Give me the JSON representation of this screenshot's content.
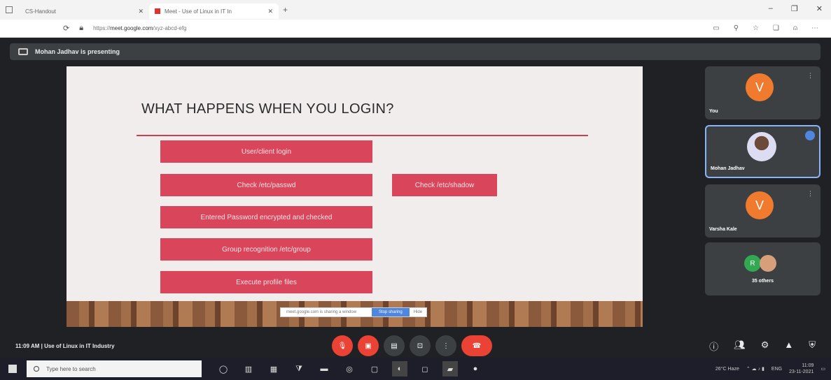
{
  "browser": {
    "tab1_title": "CS-Handout",
    "tab2_title": "Meet - Use of Linux in IT In",
    "new_tab": "+",
    "controls": [
      "–",
      "❐",
      "✕"
    ],
    "url_prefix": "https://",
    "url_host": "meet.google.com",
    "url_path": "/xyz-abcd-efg"
  },
  "meet": {
    "presenting_text": "Mohan Jadhav is presenting",
    "slide": {
      "title": "WHAT HAPPENS WHEN YOU LOGIN?",
      "boxes": [
        "User/client login",
        "Check /etc/passwd",
        "Entered Password encrypted and checked",
        "Group recognition /etc/group",
        "Execute profile files",
        "Check /etc/shadow"
      ]
    },
    "share_bar": {
      "text": "meet.google.com is sharing a window",
      "stop": "Stop sharing",
      "hide": "Hide"
    },
    "participants": [
      {
        "name": "You",
        "initial": "V"
      },
      {
        "name": "Mohan Jadhav",
        "initial": ""
      },
      {
        "name": "Varsha Kale",
        "initial": "V"
      },
      {
        "name": "35 others",
        "initial": "R"
      }
    ],
    "meeting_info": "11:09 AM  |  Use of Linux in IT Industry"
  },
  "taskbar": {
    "search_placeholder": "Type here to search",
    "weather": "26°C  Haze",
    "lang": "ENG",
    "time": "11:09",
    "date": "23-11-2021"
  }
}
